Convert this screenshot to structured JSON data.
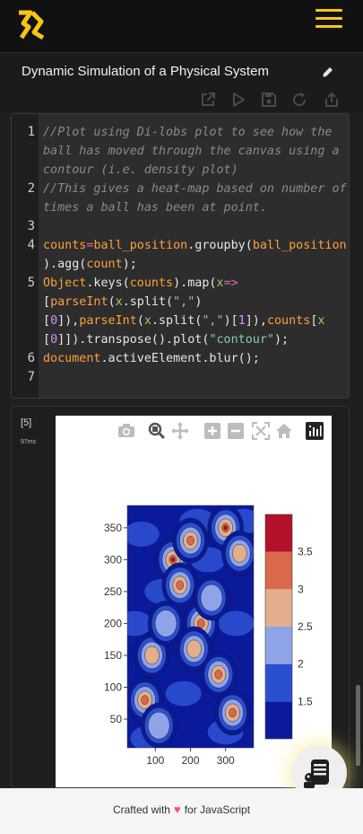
{
  "header": {
    "logo_icon": "lightning-bolt-logo-icon",
    "menu_icon": "hamburger-menu-icon",
    "accent_color": "#f5c518"
  },
  "title_bar": {
    "title": "Dynamic Simulation of a Physical System",
    "edit_icon": "pencil-icon",
    "toolbar_icons": [
      "external-link-icon",
      "play-icon",
      "save-icon",
      "refresh-icon",
      "share-icon"
    ]
  },
  "code_cell": {
    "lines": [
      {
        "num": "1",
        "segments": [
          {
            "t": "//Plot using Di-lobs plot to see how the",
            "c": "cm"
          }
        ]
      },
      {
        "num": "",
        "segments": [
          {
            "t": "ball has moved through the canvas using a",
            "c": "cm"
          }
        ]
      },
      {
        "num": "",
        "segments": [
          {
            "t": "contour (i.e. density plot)",
            "c": "cm"
          }
        ]
      },
      {
        "num": "2",
        "segments": [
          {
            "t": "//This gives a heat-map based on number of",
            "c": "cm"
          }
        ]
      },
      {
        "num": "",
        "segments": [
          {
            "t": "times a ball has been at point.",
            "c": "cm"
          }
        ]
      },
      {
        "num": "3",
        "segments": [
          {
            "t": "",
            "c": "wh"
          }
        ]
      },
      {
        "num": "4",
        "segments": [
          {
            "t": "counts",
            "c": "or"
          },
          {
            "t": "=",
            "c": "pk"
          },
          {
            "t": "ball_position",
            "c": "or"
          },
          {
            "t": ".groupby(",
            "c": "wh"
          },
          {
            "t": "ball_position",
            "c": "or"
          }
        ]
      },
      {
        "num": "",
        "segments": [
          {
            "t": ").agg(",
            "c": "wh"
          },
          {
            "t": "count",
            "c": "or"
          },
          {
            "t": ");",
            "c": "wh"
          }
        ]
      },
      {
        "num": "5",
        "segments": [
          {
            "t": "Object",
            "c": "or"
          },
          {
            "t": ".keys(",
            "c": "wh"
          },
          {
            "t": "counts",
            "c": "or"
          },
          {
            "t": ").map(",
            "c": "wh"
          },
          {
            "t": "x",
            "c": "gr"
          },
          {
            "t": "=>",
            "c": "pk"
          }
        ]
      },
      {
        "num": "",
        "segments": [
          {
            "t": "[",
            "c": "wh"
          },
          {
            "t": "parseInt",
            "c": "or"
          },
          {
            "t": "(",
            "c": "wh"
          },
          {
            "t": "x",
            "c": "gr"
          },
          {
            "t": ".split(",
            "c": "wh"
          },
          {
            "t": "\",\"",
            "c": "st"
          },
          {
            "t": ")",
            "c": "wh"
          }
        ]
      },
      {
        "num": "",
        "segments": [
          {
            "t": "[",
            "c": "wh"
          },
          {
            "t": "0",
            "c": "nu"
          },
          {
            "t": "]),",
            "c": "wh"
          },
          {
            "t": "parseInt",
            "c": "or"
          },
          {
            "t": "(",
            "c": "wh"
          },
          {
            "t": "x",
            "c": "gr"
          },
          {
            "t": ".split(",
            "c": "wh"
          },
          {
            "t": "\",\"",
            "c": "st"
          },
          {
            "t": ")[",
            "c": "wh"
          },
          {
            "t": "1",
            "c": "nu"
          },
          {
            "t": "]),",
            "c": "wh"
          },
          {
            "t": "counts",
            "c": "or"
          },
          {
            "t": "[",
            "c": "wh"
          },
          {
            "t": "x",
            "c": "gr"
          }
        ]
      },
      {
        "num": "",
        "segments": [
          {
            "t": "[",
            "c": "wh"
          },
          {
            "t": "0",
            "c": "nu"
          },
          {
            "t": "]]).transpose().plot(",
            "c": "wh"
          },
          {
            "t": "\"contour\"",
            "c": "st"
          },
          {
            "t": ");",
            "c": "wh"
          }
        ]
      },
      {
        "num": "6",
        "segments": [
          {
            "t": "document",
            "c": "or"
          },
          {
            "t": ".activeElement.blur();",
            "c": "wh"
          }
        ]
      },
      {
        "num": "7",
        "segments": [
          {
            "t": "",
            "c": "wh"
          }
        ]
      }
    ]
  },
  "output_cell": {
    "exec_count": "[5]",
    "exec_time": "97ms",
    "modebar_icons": [
      "camera-icon",
      "zoom-icon",
      "pan-icon",
      "zoom-in-icon",
      "zoom-out-icon",
      "autoscale-icon",
      "home-icon",
      "plotly-logo-icon"
    ]
  },
  "chart_data": {
    "type": "heatmap",
    "variant": "contour",
    "x_ticks": [
      100,
      200,
      300
    ],
    "y_ticks": [
      50,
      100,
      150,
      200,
      250,
      300,
      350
    ],
    "xlim": [
      20,
      380
    ],
    "ylim": [
      5,
      385
    ],
    "colorbar": {
      "ticks": [
        1.5,
        2,
        2.5,
        3,
        3.5
      ],
      "range": [
        1,
        4
      ],
      "levels": [
        {
          "from": 1.0,
          "to": 1.5,
          "color": "#0a1a9a"
        },
        {
          "from": 1.5,
          "to": 2.0,
          "color": "#2b4fd1"
        },
        {
          "from": 2.0,
          "to": 2.5,
          "color": "#8fa4e8"
        },
        {
          "from": 2.5,
          "to": 3.0,
          "color": "#e2ae8c"
        },
        {
          "from": 3.0,
          "to": 3.5,
          "color": "#d9694a"
        },
        {
          "from": 3.5,
          "to": 4.0,
          "color": "#b2102b"
        }
      ]
    },
    "hotspots": [
      {
        "x": 150,
        "y": 300,
        "level": 3.6
      },
      {
        "x": 200,
        "y": 330,
        "level": 3.4
      },
      {
        "x": 170,
        "y": 260,
        "level": 3.2
      },
      {
        "x": 230,
        "y": 200,
        "level": 3.5
      },
      {
        "x": 210,
        "y": 160,
        "level": 2.8
      },
      {
        "x": 280,
        "y": 120,
        "level": 3.3
      },
      {
        "x": 320,
        "y": 60,
        "level": 3.5
      },
      {
        "x": 90,
        "y": 150,
        "level": 2.7
      },
      {
        "x": 70,
        "y": 80,
        "level": 3.4
      },
      {
        "x": 300,
        "y": 350,
        "level": 3.6
      },
      {
        "x": 340,
        "y": 310,
        "level": 2.6
      },
      {
        "x": 130,
        "y": 200,
        "level": 2.4
      },
      {
        "x": 260,
        "y": 240,
        "level": 2.5
      },
      {
        "x": 110,
        "y": 40,
        "level": 2.3
      }
    ]
  },
  "fab": {
    "icon": "robot-assistant-icon"
  },
  "footer": {
    "prefix": "Crafted with",
    "heart": "♥",
    "suffix": "for JavaScript"
  }
}
